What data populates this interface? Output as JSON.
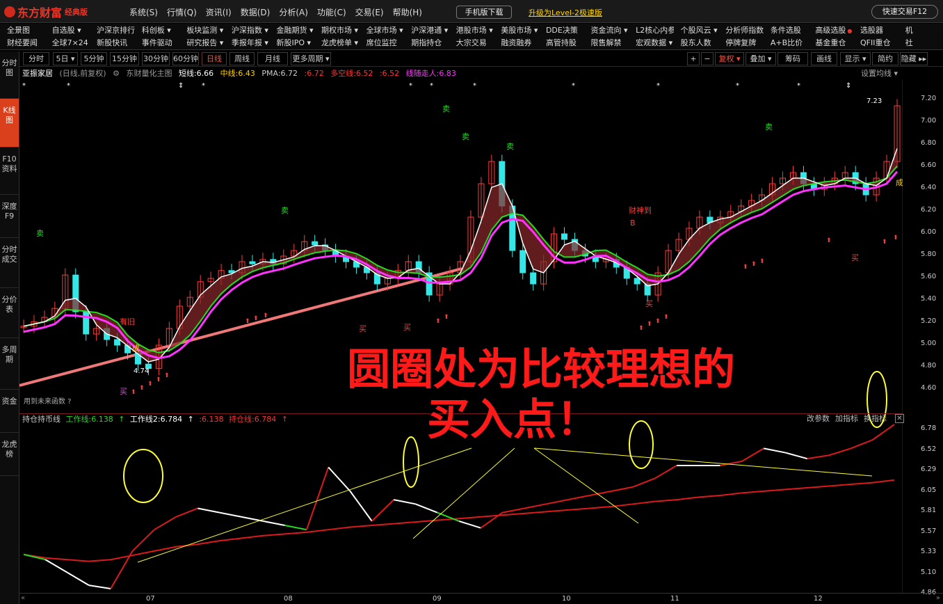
{
  "app": {
    "name": "东方财富",
    "edition": "经典版",
    "menu": [
      "系统(S)",
      "行情(Q)",
      "资讯(I)",
      "数据(D)",
      "分析(A)",
      "功能(C)",
      "交易(E)",
      "帮助(H)"
    ],
    "mobile_download": "手机版下载",
    "upgrade": "升级为Level-2极速版",
    "quick_trade": "快速交易F12"
  },
  "nav": {
    "row1": [
      "全景图",
      "自选股 ▾",
      "沪深京排行 ▾",
      "科创板 ▾",
      "板块监测 ▾",
      "沪深指数 ▾",
      "金融期货 ▾",
      "期权市场 ▾",
      "全球市场 ▾",
      "沪深港通 ▾",
      "港股市场 ▾",
      "美股市场 ▾",
      "DDE决策",
      "资金流向 ▾",
      "L2核心内参",
      "个股风云 ▾",
      "分析师指数",
      "条件选股",
      "高级选股",
      "选股器",
      "机"
    ],
    "row2": [
      "财经要闻",
      "全球7×24",
      "新股快讯",
      "事件驱动",
      "研究报告 ▾",
      "季报年报 ▾",
      "新股IPO ▾",
      "龙虎榜单 ▾",
      "席位监控",
      "期指持仓",
      "大宗交易",
      "融资融券",
      "高管持股",
      "限售解禁",
      "宏观数据 ▾",
      "股东人数",
      "停牌复牌",
      "A+B比价",
      "基金重仓",
      "QFII重仓",
      "社"
    ]
  },
  "period_tabs": [
    "分时",
    "5日 ▾",
    "5分钟",
    "15分钟",
    "30分钟",
    "60分钟",
    "日线",
    "周线",
    "月线",
    "更多周期 ▾"
  ],
  "active_period": "日线",
  "right_tools": [
    "+",
    "−",
    "复权 ▾",
    "叠加 ▾",
    "筹码",
    "画线",
    "显示 ▾",
    "简约",
    "隐藏 ▸▸"
  ],
  "sidebar": [
    {
      "label": "分时图",
      "active": false
    },
    {
      "label": "K线图",
      "active": true
    },
    {
      "label": "F10资料",
      "active": false
    },
    {
      "label": "深度F9",
      "active": false
    },
    {
      "label": "分时成交",
      "active": false
    },
    {
      "label": "分价表",
      "active": false
    },
    {
      "label": "多周期",
      "active": false
    },
    {
      "label": "资金",
      "active": false
    },
    {
      "label": "龙虎榜",
      "active": false
    }
  ],
  "info": {
    "stock": "亚振家居",
    "mode": "(日线,前复权)",
    "quant": "东财量化主图",
    "short": "短线:6.66",
    "mid": "中线:6.43",
    "pma": "PMA:6.72",
    "v1": ":6.72",
    "multi": "多空线:6.52",
    "v2": ":6.52",
    "trend": "线随走人:6.83",
    "settings": "设置均线 ▾"
  },
  "price_labels": [
    "7.20",
    "7.00",
    "6.80",
    "6.60",
    "6.40",
    "6.20",
    "6.00",
    "5.80",
    "5.60",
    "5.40",
    "5.20",
    "5.00",
    "4.80",
    "4.60"
  ],
  "sub_labels": [
    "6.78",
    "6.52",
    "6.29",
    "6.05",
    "5.81",
    "5.57",
    "5.33",
    "5.10",
    "4.86"
  ],
  "sub": {
    "name": "持仓持币线",
    "work1": "工作线:6.138",
    "work2": "工作线2:6.784",
    "v1": ":6.138",
    "hold": "持仓线:6.784",
    "tools": [
      "改参数",
      "加指标",
      "换指标"
    ]
  },
  "months": [
    "07",
    "08",
    "09",
    "10",
    "11",
    "12"
  ],
  "future_note": "用到未来函数 ?",
  "annotation": {
    "line1": "圆圈处为比较理想的",
    "line2": "买入点！"
  },
  "signals": {
    "sell": "卖",
    "buy": "买",
    "peak": "7.23",
    "low": "4.74",
    "label_have": "有旧",
    "label_cheng": "成",
    "label_fuzhen": "财神到",
    "label_b": "B",
    "label_cj": "成"
  },
  "chart_data": {
    "type": "line",
    "price": [
      5.12,
      5.16,
      5.2,
      5.28,
      5.58,
      5.25,
      5.05,
      5.1,
      5.0,
      4.95,
      4.88,
      4.78,
      4.74,
      4.95,
      5.1,
      5.3,
      5.38,
      5.52,
      5.55,
      5.62,
      5.6,
      5.7,
      5.68,
      5.72,
      5.68,
      5.75,
      5.8,
      5.88,
      5.85,
      5.8,
      5.75,
      5.7,
      5.65,
      5.6,
      5.5,
      5.55,
      5.62,
      5.7,
      5.6,
      5.4,
      5.5,
      5.6,
      5.7,
      6.1,
      6.4,
      6.6,
      6.2,
      5.8,
      5.6,
      5.5,
      5.7,
      5.95,
      5.9,
      5.8,
      5.75,
      5.7,
      5.72,
      5.65,
      5.55,
      5.5,
      5.4,
      5.6,
      5.8,
      5.9,
      6.0,
      6.1,
      6.05,
      6.1,
      6.15,
      6.2,
      6.25,
      6.3,
      6.4,
      6.45,
      6.5,
      6.4,
      6.35,
      6.4,
      6.45,
      6.5,
      6.4,
      6.3,
      6.45,
      6.6,
      7.1
    ],
    "hold_line": [
      5.26,
      5.22,
      5.2,
      5.18,
      5.2,
      5.25,
      5.3,
      5.35,
      5.38,
      5.42,
      5.45,
      5.48,
      5.5,
      5.52,
      5.55,
      5.58,
      5.6,
      5.62,
      5.64,
      5.66,
      5.68,
      5.7,
      5.72,
      5.74,
      5.76,
      5.78,
      5.8,
      5.82,
      5.85,
      5.88,
      5.9,
      5.93,
      5.95,
      5.98,
      6.0,
      6.02,
      6.04,
      6.06,
      6.08,
      6.1,
      6.13
    ],
    "work_line": [
      5.26,
      5.2,
      5.05,
      4.9,
      4.86,
      5.3,
      5.55,
      5.7,
      5.8,
      5.75,
      5.7,
      5.65,
      5.6,
      5.55,
      6.28,
      6.0,
      5.65,
      5.9,
      5.85,
      5.75,
      5.65,
      5.57,
      5.75,
      5.8,
      5.85,
      5.9,
      5.95,
      6.0,
      6.05,
      6.15,
      6.3,
      6.3,
      6.3,
      6.35,
      6.5,
      6.45,
      6.38,
      6.42,
      6.5,
      6.6,
      6.78
    ],
    "ylim_price": [
      4.55,
      7.3
    ],
    "ylim_sub": [
      4.86,
      6.78
    ]
  }
}
